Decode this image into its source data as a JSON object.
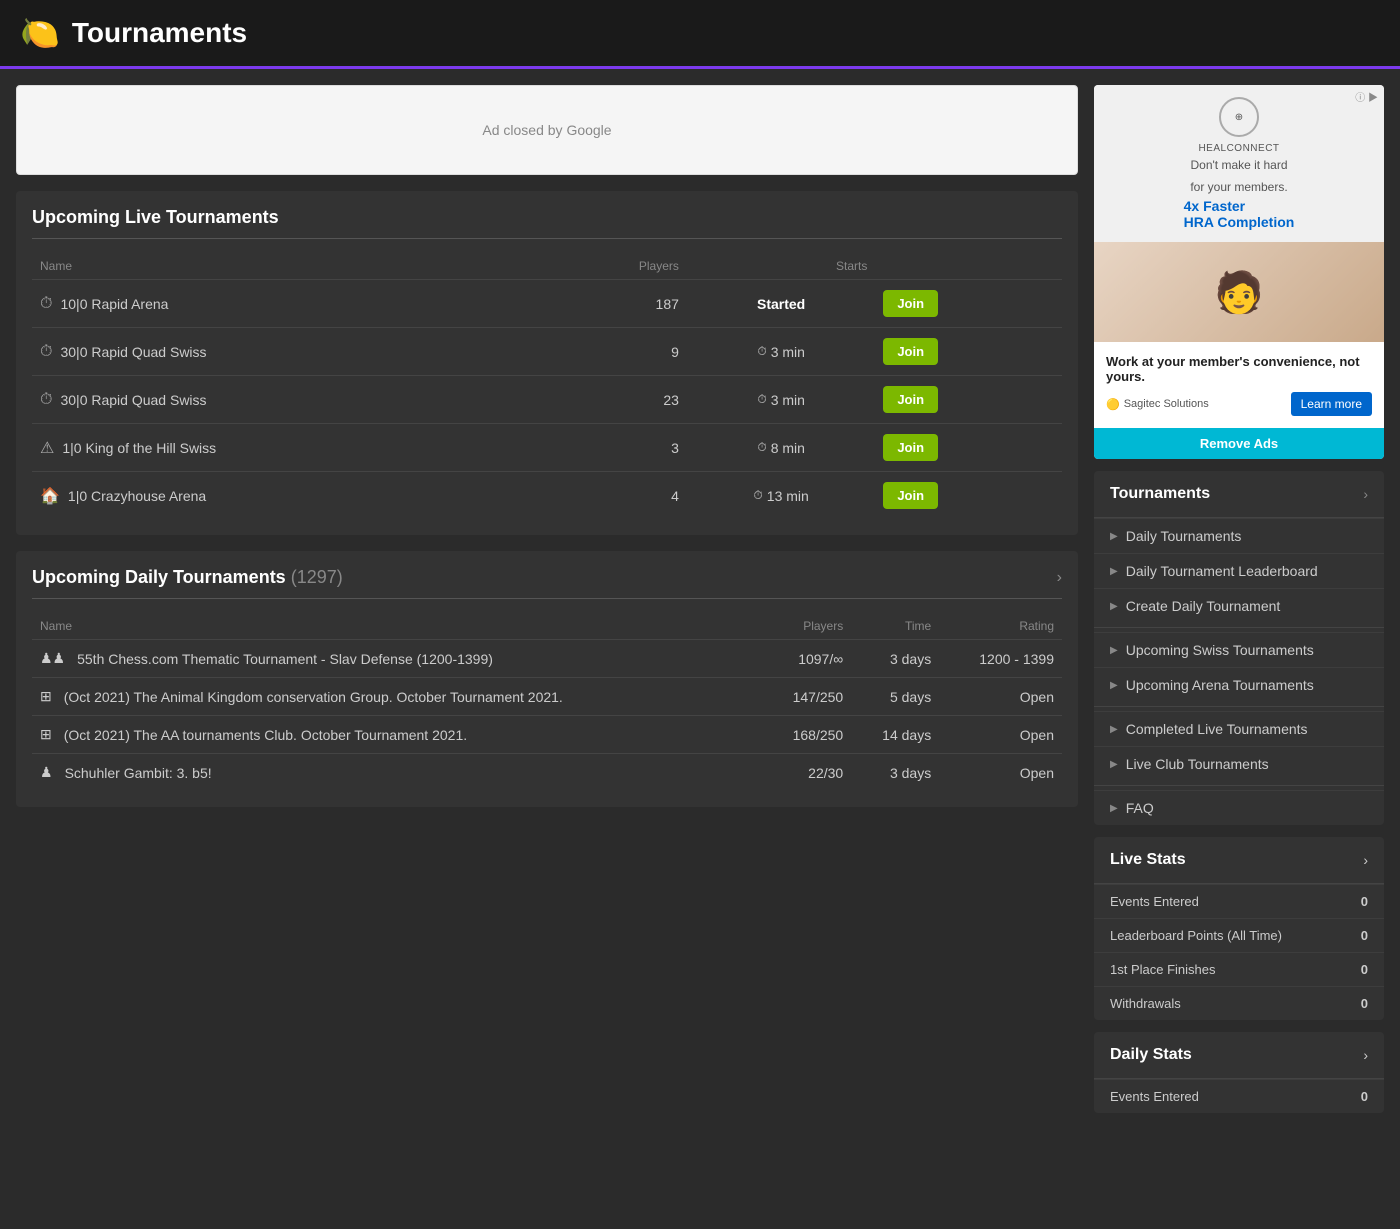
{
  "header": {
    "icon": "🍋",
    "title": "Tournaments"
  },
  "ad_banner": {
    "text": "Ad closed by Google"
  },
  "upcoming_live": {
    "section_title": "Upcoming Live Tournaments",
    "columns": {
      "name": "Name",
      "players": "Players",
      "starts": "Starts"
    },
    "rows": [
      {
        "icon": "⏱",
        "name": "10|0 Rapid Arena",
        "players": "187",
        "starts": "Started",
        "started": true
      },
      {
        "icon": "⏱",
        "name": "30|0 Rapid Quad Swiss",
        "players": "9",
        "starts": "3 min",
        "started": false
      },
      {
        "icon": "⏱",
        "name": "30|0 Rapid Quad Swiss",
        "players": "23",
        "starts": "3 min",
        "started": false
      },
      {
        "icon": "⚠",
        "name": "1|0 King of the Hill Swiss",
        "players": "3",
        "starts": "8 min",
        "started": false
      },
      {
        "icon": "🏠",
        "name": "1|0 Crazyhouse Arena",
        "players": "4",
        "starts": "13 min",
        "started": false
      }
    ],
    "join_label": "Join"
  },
  "upcoming_daily": {
    "section_title": "Upcoming Daily Tournaments",
    "count": "1297",
    "columns": {
      "name": "Name",
      "players": "Players",
      "time": "Time",
      "rating": "Rating"
    },
    "rows": [
      {
        "icons": "♟♟",
        "name": "55th Chess.com Thematic Tournament - Slav Defense (1200-1399)",
        "players": "1097/∞",
        "time": "3 days",
        "rating": "1200 - 1399"
      },
      {
        "icons": "⊞",
        "name": "(Oct 2021) The Animal Kingdom conservation Group. October Tournament 2021.",
        "players": "147/250",
        "time": "5 days",
        "rating": "Open"
      },
      {
        "icons": "⊞",
        "name": "(Oct 2021) The AA tournaments Club. October Tournament 2021.",
        "players": "168/250",
        "time": "14 days",
        "rating": "Open"
      },
      {
        "icons": "♟",
        "name": "Schuhler Gambit: 3. b5!",
        "players": "22/30",
        "time": "3 days",
        "rating": "Open"
      }
    ]
  },
  "sidebar": {
    "ad": {
      "brand": "HEALCONNECT",
      "tagline_line1": "Don't make it hard",
      "tagline_line2": "for your members.",
      "highlight": "4x Faster\nHRA Completion",
      "headline": "Work at your member's convenience, not yours.",
      "company": "Sagitec Solutions",
      "learn_btn": "Learn more",
      "remove_ads": "Remove Ads"
    },
    "tournaments_nav": {
      "title": "Tournaments",
      "items_group1": [
        "Daily Tournaments",
        "Daily Tournament Leaderboard",
        "Create Daily Tournament"
      ],
      "items_group2": [
        "Upcoming Swiss Tournaments",
        "Upcoming Arena Tournaments"
      ],
      "items_group3": [
        "Completed Live Tournaments",
        "Live Club Tournaments"
      ],
      "items_group4": [
        "FAQ"
      ]
    },
    "live_stats": {
      "title": "Live Stats",
      "rows": [
        {
          "label": "Events Entered",
          "value": "0"
        },
        {
          "label": "Leaderboard Points (All Time)",
          "value": "0"
        },
        {
          "label": "1st Place Finishes",
          "value": "0"
        },
        {
          "label": "Withdrawals",
          "value": "0"
        }
      ]
    },
    "daily_stats": {
      "title": "Daily Stats",
      "rows": [
        {
          "label": "Events Entered",
          "value": "0"
        }
      ]
    }
  }
}
